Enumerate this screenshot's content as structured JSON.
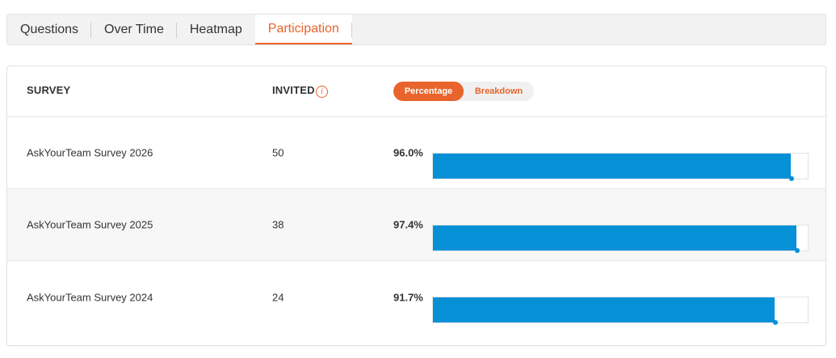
{
  "tabs": [
    {
      "label": "Questions",
      "active": false
    },
    {
      "label": "Over Time",
      "active": false
    },
    {
      "label": "Heatmap",
      "active": false
    },
    {
      "label": "Participation",
      "active": true
    }
  ],
  "table": {
    "columns": {
      "survey": "SURVEY",
      "invited": "INVITED"
    },
    "toggle": {
      "percentage": "Percentage",
      "breakdown": "Breakdown",
      "selected": "Percentage"
    },
    "rows": [
      {
        "name": "AskYourTeam Survey 2026",
        "invited": "50",
        "participation": "96.0%",
        "value": 96.0
      },
      {
        "name": "AskYourTeam Survey 2025",
        "invited": "38",
        "participation": "97.4%",
        "value": 97.4
      },
      {
        "name": "AskYourTeam Survey 2024",
        "invited": "24",
        "participation": "91.7%",
        "value": 91.7
      }
    ]
  },
  "colors": {
    "accent": "#e8642c",
    "bar": "#0691d7"
  },
  "icons": {
    "invited_info": "info-icon"
  }
}
